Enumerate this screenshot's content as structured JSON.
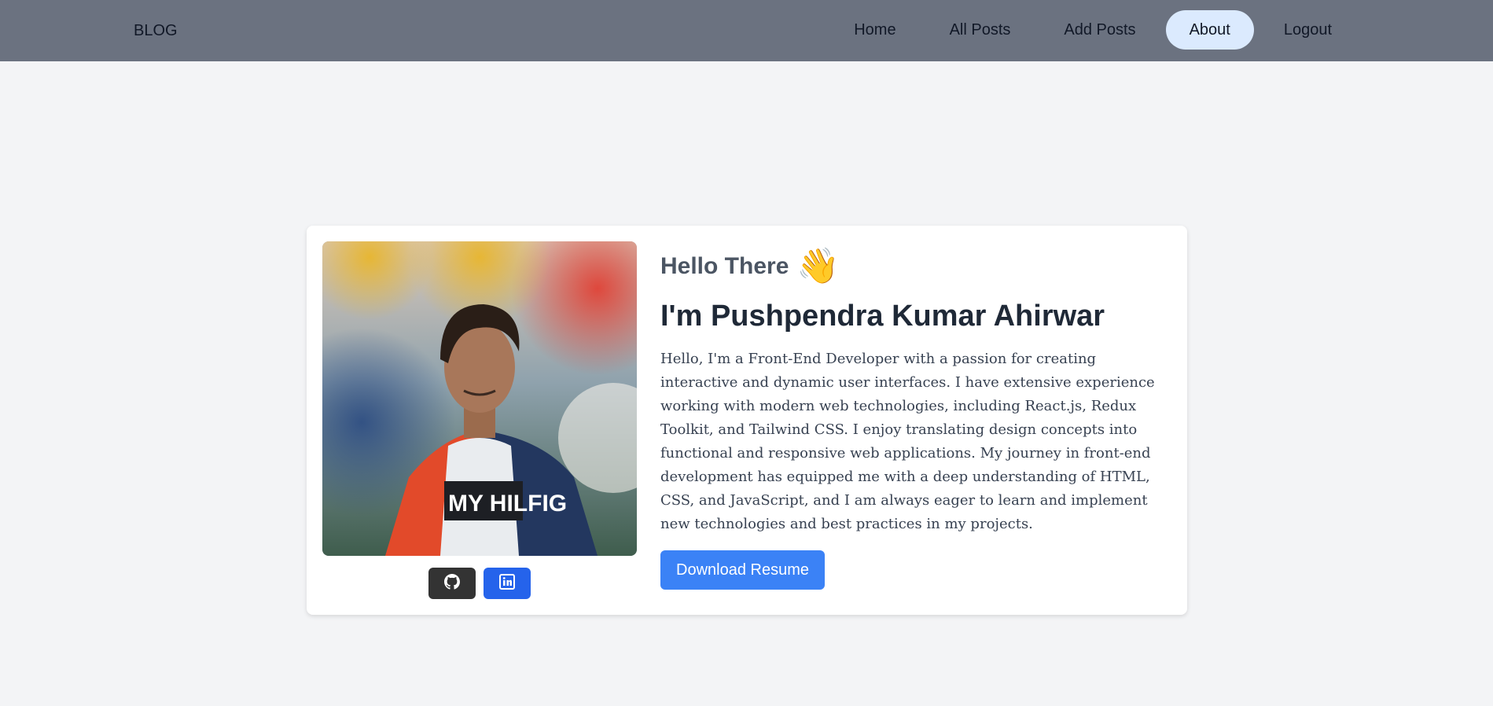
{
  "nav": {
    "brand": "BLOG",
    "items": [
      {
        "label": "Home",
        "active": false
      },
      {
        "label": "All Posts",
        "active": false
      },
      {
        "label": "Add Posts",
        "active": false
      },
      {
        "label": "About",
        "active": true
      },
      {
        "label": "Logout",
        "active": false
      }
    ]
  },
  "profile": {
    "greeting": "Hello There",
    "wave_emoji": "👋",
    "name": "I'm Pushpendra Kumar Ahirwar",
    "bio": "Hello, I'm a Front-End Developer with a passion for creating interactive and dynamic user interfaces. I have extensive experience working with modern web technologies, including React.js, Redux Toolkit, and Tailwind CSS. I enjoy translating design concepts into functional and responsive web applications. My journey in front-end development has equipped me with a deep understanding of HTML, CSS, and JavaScript, and I am always eager to learn and implement new technologies and best practices in my projects.",
    "download_label": "Download Resume",
    "photo_shirt_text": "MY HILFIG"
  },
  "socials": [
    {
      "name": "github",
      "icon": "github-icon",
      "color": "#333333"
    },
    {
      "name": "linkedin",
      "icon": "linkedin-icon",
      "color": "#2563eb"
    }
  ],
  "colors": {
    "navbar": "#6b7280",
    "active_nav": "#dbeafe",
    "page_bg": "#f3f4f6",
    "button": "#3b82f6"
  }
}
